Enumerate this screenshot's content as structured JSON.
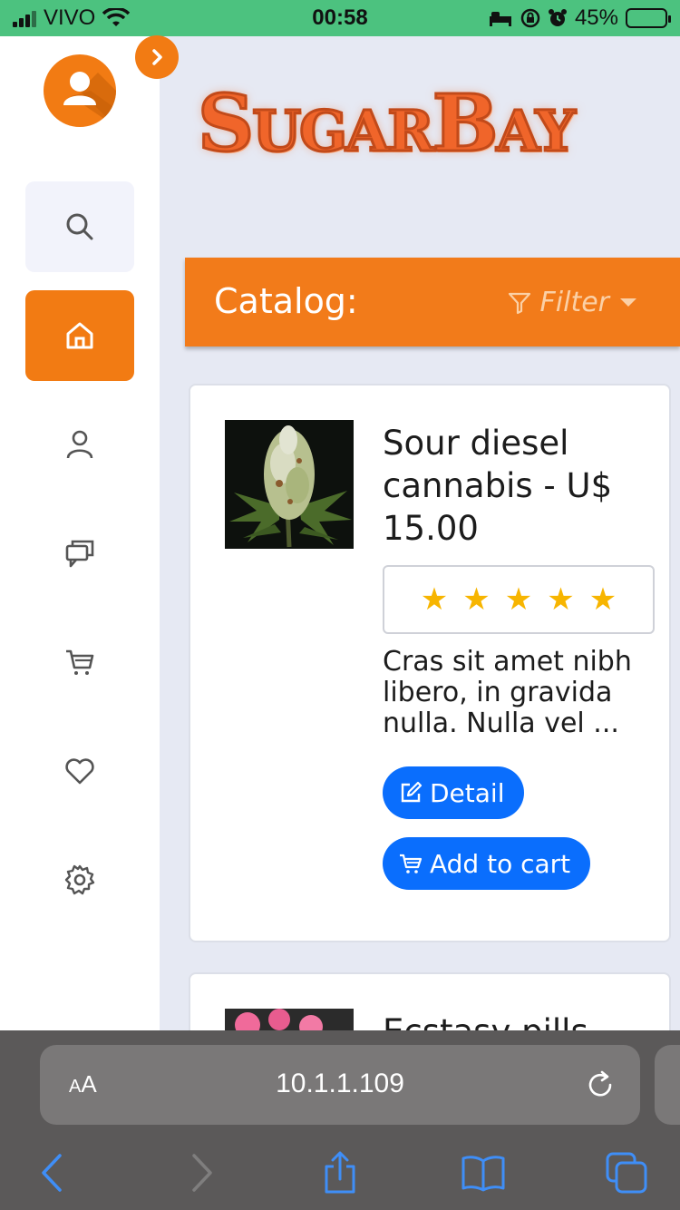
{
  "status_bar": {
    "carrier": "VIVO",
    "time": "00:58",
    "battery": "45%",
    "battery_level": 0.45
  },
  "logo": {
    "text_big1": "S",
    "text_small1": "UGAR",
    "text_big2": "B",
    "text_small2": "AY"
  },
  "sidebar": {
    "items": [
      {
        "name": "search",
        "icon": "search-icon"
      },
      {
        "name": "home",
        "icon": "home-icon",
        "active": true
      },
      {
        "name": "user",
        "icon": "user-icon"
      },
      {
        "name": "chat",
        "icon": "chat-icon"
      },
      {
        "name": "cart",
        "icon": "cart-icon"
      },
      {
        "name": "favorites",
        "icon": "heart-icon"
      },
      {
        "name": "settings",
        "icon": "gear-icon"
      }
    ]
  },
  "catalog": {
    "title": "Catalog:",
    "filter_label": "Filter"
  },
  "products": [
    {
      "title": "Sour diesel cannabis - U$ 15.00",
      "rating": 5,
      "stars": [
        "★",
        "★",
        "★",
        "★",
        "★"
      ],
      "description": "Cras sit amet nibh libero, in gravida nulla. Nulla vel ...",
      "detail_label": "Detail",
      "cart_label": "Add to cart"
    },
    {
      "title": "Ecstasy pills -"
    }
  ],
  "browser": {
    "aa_label_small": "A",
    "aa_label_big": "A",
    "url": "10.1.1.109"
  },
  "colors": {
    "accent": "#f27b13",
    "button_blue": "#0a6efd",
    "star": "#f7b500",
    "status_green": "#4cc27f"
  }
}
